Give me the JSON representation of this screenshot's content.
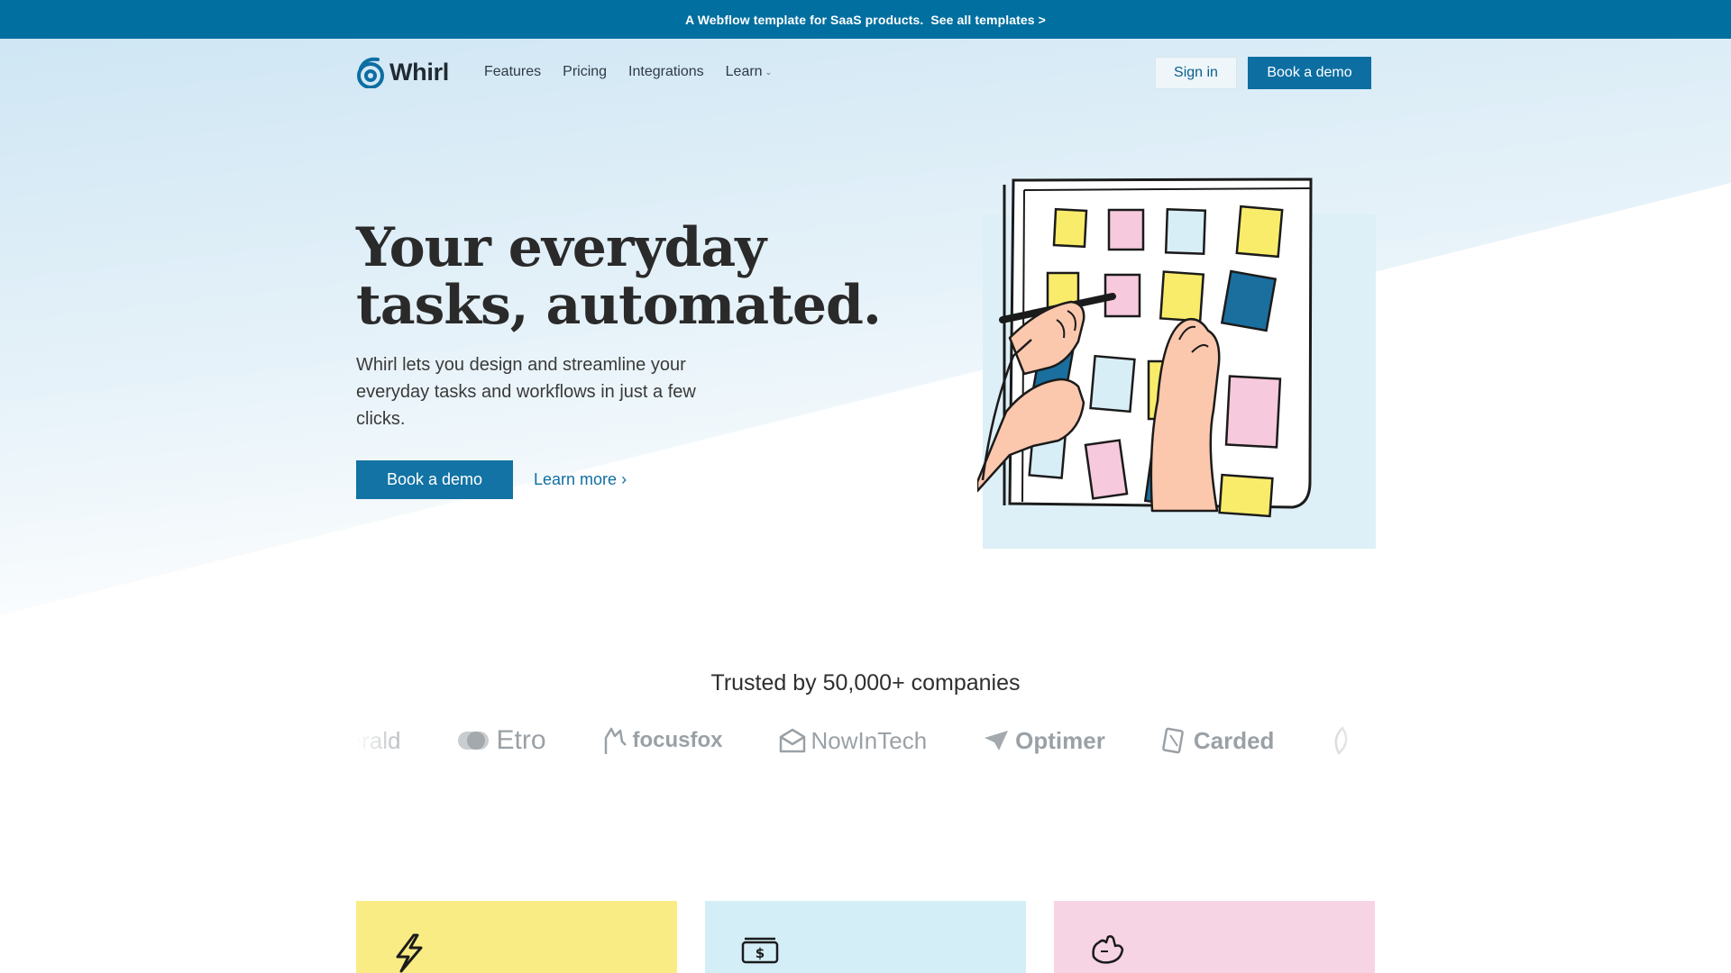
{
  "banner": {
    "text": "A Webflow template for SaaS products.",
    "link": "See all templates >"
  },
  "nav": {
    "brand": "Whirl",
    "links": [
      {
        "label": "Features"
      },
      {
        "label": "Pricing"
      },
      {
        "label": "Integrations"
      },
      {
        "label": "Learn",
        "has_dropdown": true
      }
    ],
    "signin": "Sign in",
    "demo": "Book a demo"
  },
  "hero": {
    "title_line1": "Your everyday",
    "title_line2": "tasks, automated.",
    "subtitle": "Whirl lets you design and streamline your everyday tasks and workflows in just a few clicks.",
    "cta_primary": "Book a demo",
    "cta_secondary": "Learn more"
  },
  "trusted": {
    "heading": "Trusted by 50,000+ companies",
    "logos": [
      "merald",
      "Etro",
      "focusfox",
      "NowInTech",
      "Optimer",
      "Carded"
    ]
  },
  "feature_cards": [
    {
      "color": "#f9ec85",
      "icon": "lightning-icon"
    },
    {
      "color": "#d3eef7",
      "icon": "money-icon"
    },
    {
      "color": "#f7d4e3",
      "icon": "hand-icon"
    }
  ],
  "colors": {
    "primary": "#0d6ea2",
    "banner": "#016fa0",
    "hero_gradient_top": "#d4e9f5",
    "sticky_yellow": "#f9ec6b",
    "sticky_pink": "#f7c9dc",
    "sticky_light_blue": "#d8eef7",
    "sticky_dark_blue": "#1b6f9f"
  }
}
